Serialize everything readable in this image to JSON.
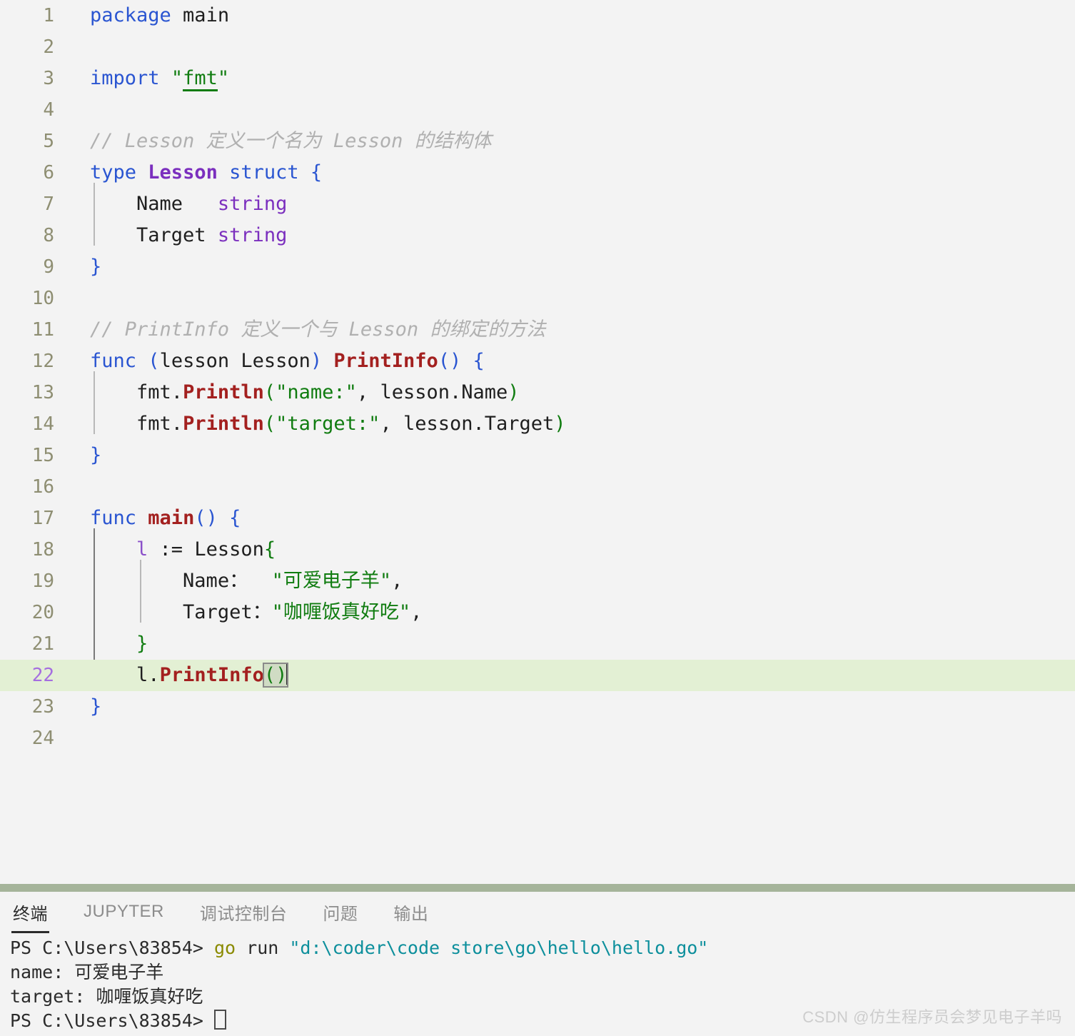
{
  "editor": {
    "language": "go",
    "active_line": 22,
    "lines": [
      {
        "n": "1",
        "text": "package main"
      },
      {
        "n": "2",
        "text": ""
      },
      {
        "n": "3",
        "text": "import \"fmt\""
      },
      {
        "n": "4",
        "text": ""
      },
      {
        "n": "5",
        "text": "// Lesson 定义一个名为 Lesson 的结构体"
      },
      {
        "n": "6",
        "text": "type Lesson struct {"
      },
      {
        "n": "7",
        "text": "    Name   string"
      },
      {
        "n": "8",
        "text": "    Target string"
      },
      {
        "n": "9",
        "text": "}"
      },
      {
        "n": "10",
        "text": ""
      },
      {
        "n": "11",
        "text": "// PrintInfo 定义一个与 Lesson 的绑定的方法"
      },
      {
        "n": "12",
        "text": "func (lesson Lesson) PrintInfo() {"
      },
      {
        "n": "13",
        "text": "    fmt.Println(\"name:\", lesson.Name)"
      },
      {
        "n": "14",
        "text": "    fmt.Println(\"target:\", lesson.Target)"
      },
      {
        "n": "15",
        "text": "}"
      },
      {
        "n": "16",
        "text": ""
      },
      {
        "n": "17",
        "text": "func main() {"
      },
      {
        "n": "18",
        "text": "    l := Lesson{"
      },
      {
        "n": "19",
        "text": "        Name：  \"可爱电子羊\","
      },
      {
        "n": "20",
        "text": "        Target：\"咖喱饭真好吃\","
      },
      {
        "n": "21",
        "text": "    }"
      },
      {
        "n": "22",
        "text": "    l.PrintInfo()"
      },
      {
        "n": "23",
        "text": "}"
      },
      {
        "n": "24",
        "text": ""
      }
    ],
    "tokens": {
      "l1_kw": "package",
      "l1_rest": " main",
      "l3_kw": "import",
      "l3_q1": "\"",
      "l3_pkg": "fmt",
      "l3_q2": "\"",
      "l5_comment": "// Lesson 定义一个名为 Lesson 的结构体",
      "l6_kw1": "type",
      "l6_type": "Lesson",
      "l6_kw2": "struct",
      "l6_brace": "{",
      "l7_field": "Name",
      "l7_type": "string",
      "l8_field": "Target",
      "l8_type": "string",
      "l9_brace": "}",
      "l11_comment": "// PrintInfo 定义一个与 Lesson 的绑定的方法",
      "l12_kw": "func",
      "l12_recv_open": "(",
      "l12_recv": "lesson Lesson",
      "l12_recv_close": ")",
      "l12_fn": "PrintInfo",
      "l12_parens": "()",
      "l12_brace": "{",
      "l13_pkg": "fmt.",
      "l13_fn": "Println",
      "l13_open": "(",
      "l13_str": "\"name:\"",
      "l13_comma": ", ",
      "l13_arg": "lesson.Name",
      "l13_close": ")",
      "l14_pkg": "fmt.",
      "l14_fn": "Println",
      "l14_open": "(",
      "l14_str": "\"target:\"",
      "l14_comma": ", ",
      "l14_arg": "lesson.Target",
      "l14_close": ")",
      "l15_brace": "}",
      "l17_kw": "func",
      "l17_fn": "main",
      "l17_parens": "()",
      "l17_brace": "{",
      "l18_var": "l",
      "l18_assign": " := ",
      "l18_type": "Lesson",
      "l18_brace": "{",
      "l19_key": "Name：",
      "l19_val": "\"可爱电子羊\"",
      "l19_comma": ",",
      "l20_key": "Target：",
      "l20_val": "\"咖喱饭真好吃\"",
      "l20_comma": ",",
      "l21_brace": "}",
      "l22_var": "l",
      "l22_dot": ".",
      "l22_fn": "PrintInfo",
      "l22_parens": "()",
      "l23_brace": "}"
    }
  },
  "panel": {
    "tabs": [
      {
        "label": "终端",
        "active": true
      },
      {
        "label": "JUPYTER",
        "active": false
      },
      {
        "label": "调试控制台",
        "active": false
      },
      {
        "label": "问题",
        "active": false
      },
      {
        "label": "输出",
        "active": false
      }
    ],
    "terminal": {
      "prompt": "PS C:\\Users\\83854> ",
      "command_name": "go",
      "command_mid": " run ",
      "command_path": "\"d:\\coder\\code store\\go\\hello\\hello.go\"",
      "output_line_1": "name: 可爱电子羊",
      "output_line_2": "target: 咖喱饭真好吃",
      "prompt_2": "PS C:\\Users\\83854> "
    }
  },
  "watermark": {
    "text": "CSDN @仿生程序员会梦见电子羊吗"
  },
  "colors": {
    "background": "#f3f3f3",
    "active_line": "#e3f0d4",
    "divider": "#a5b49a",
    "keyword": "#2a55d1",
    "type": "#7b2fbe",
    "function": "#a3201f",
    "string": "#107c10",
    "comment": "#b0b0b0",
    "line_number": "#8e8e72",
    "active_line_number": "#a56ee0",
    "terminal_command": "#8a8a00",
    "terminal_path": "#0d8f9c"
  }
}
